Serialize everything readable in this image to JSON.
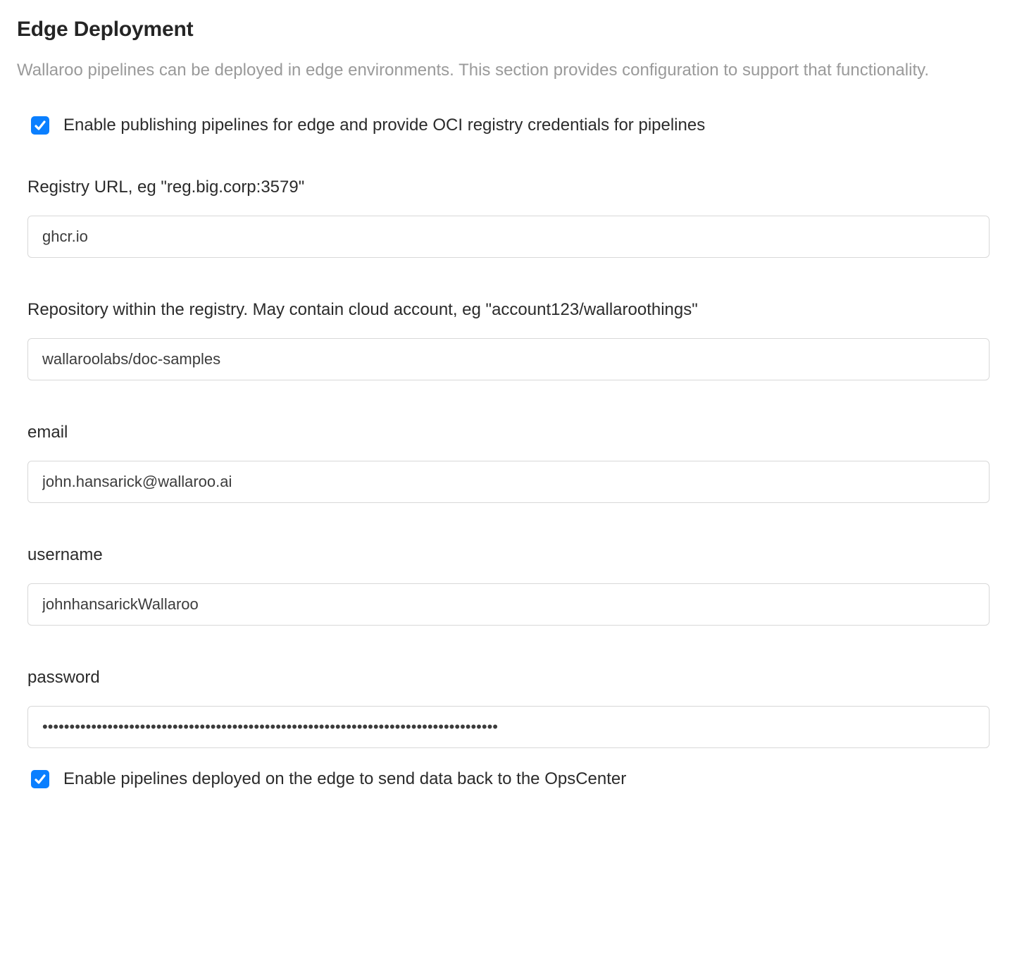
{
  "section": {
    "title": "Edge Deployment",
    "description": "Wallaroo pipelines can be deployed in edge environments. This section provides configuration to support that functionality."
  },
  "enable_publishing": {
    "checked": true,
    "label": "Enable publishing pipelines for edge and provide OCI registry credentials for pipelines"
  },
  "fields": {
    "registry_url": {
      "label": "Registry URL, eg \"reg.big.corp:3579\"",
      "value": "ghcr.io"
    },
    "repository": {
      "label": "Repository within the registry. May contain cloud account, eg \"account123/wallaroothings\"",
      "value": "wallaroolabs/doc-samples"
    },
    "email": {
      "label": "email",
      "value": "john.hansarick@wallaroo.ai"
    },
    "username": {
      "label": "username",
      "value": "johnhansarickWallaroo"
    },
    "password": {
      "label": "password",
      "value": "••••••••••••••••••••••••••••••••••••••••••••••••••••••••••••••••••••••••••••••••••••"
    }
  },
  "enable_edge_send": {
    "checked": true,
    "label": "Enable pipelines deployed on the edge to send data back to the OpsCenter"
  }
}
